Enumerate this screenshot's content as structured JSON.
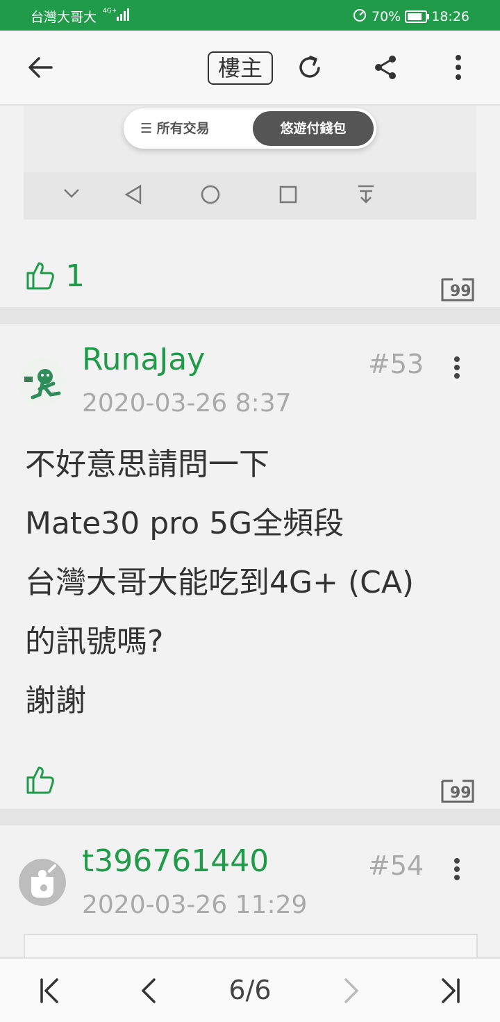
{
  "status_bar": {
    "carrier": "台灣大哥大",
    "network": "4G+",
    "battery": "70%",
    "time": "18:26"
  },
  "top_nav": {
    "op_only_label": "樓主"
  },
  "embed": {
    "all_transactions": "所有交易",
    "wallet": "悠遊付錢包"
  },
  "post_prev": {
    "likes": "1"
  },
  "posts": [
    {
      "username": "RunaJay",
      "floor": "#53",
      "datetime": "2020-03-26 8:37",
      "lines": [
        "不好意思請問一下",
        "Mate30 pro 5G全頻段",
        "台灣大哥大能吃到4G+ (CA)",
        "的訊號嗎?",
        "謝謝"
      ]
    },
    {
      "username": "t396761440",
      "floor": "#54",
      "datetime": "2020-03-26 11:29"
    }
  ],
  "pagination": {
    "label": "6/6"
  },
  "colors": {
    "accent": "#1f9b4a",
    "status_bar": "#1f9b4a"
  }
}
